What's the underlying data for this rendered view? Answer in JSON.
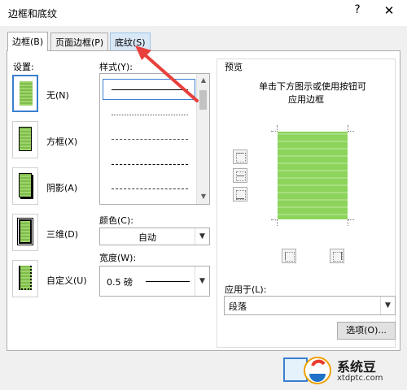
{
  "window": {
    "title": "边框和底纹",
    "help": "?",
    "close": "✕"
  },
  "tabs": [
    {
      "label": "边框(B)"
    },
    {
      "label": "页面边框(P)"
    },
    {
      "label": "底纹(S)"
    }
  ],
  "settings": {
    "label": "设置:",
    "items": [
      {
        "label": "无(N)"
      },
      {
        "label": "方框(X)"
      },
      {
        "label": "阴影(A)"
      },
      {
        "label": "三维(D)"
      },
      {
        "label": "自定义(U)"
      }
    ]
  },
  "style": {
    "label": "样式(Y):"
  },
  "color": {
    "label": "颜色(C):",
    "value": "自动"
  },
  "width": {
    "label": "宽度(W):",
    "value": "0.5 磅"
  },
  "preview": {
    "label": "预览",
    "hint_line1": "单击下方图示或使用按钮可",
    "hint_line2": "应用边框"
  },
  "apply_to": {
    "label": "应用于(L):",
    "value": "段落"
  },
  "options_button": "选项(O)...",
  "watermark": {
    "name": "系统豆",
    "url": "xtdptc.com"
  },
  "colors": {
    "accent": "#3a7fd0",
    "arrow": "#e8403c",
    "preview_green": "#8cd45c"
  }
}
